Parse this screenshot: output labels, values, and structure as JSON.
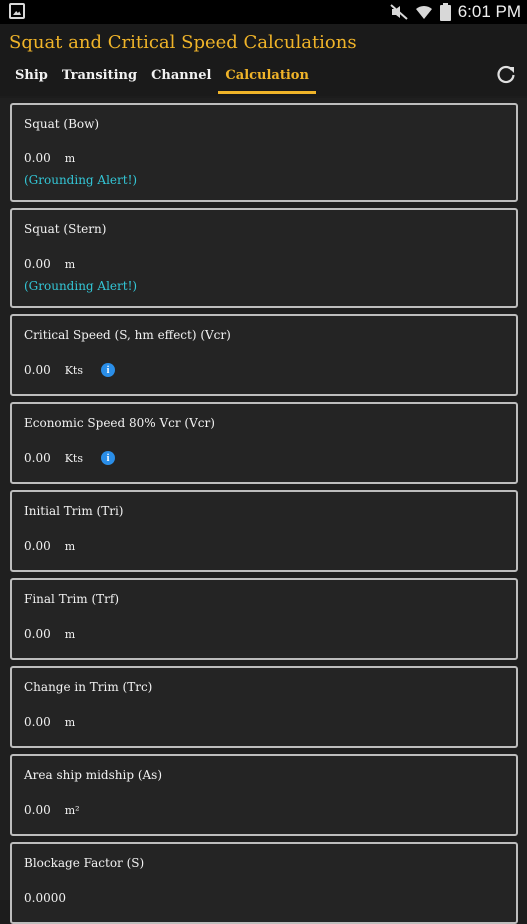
{
  "status_bar": {
    "time": "6:01 PM",
    "icons": [
      "image-icon",
      "mute-icon",
      "wifi-icon",
      "battery-icon"
    ]
  },
  "app": {
    "title": "Squat and Critical Speed Calculations",
    "accent_color": "#f0b429",
    "alert_color": "#33c6d6",
    "tabs": [
      {
        "label": "Ship",
        "active": false
      },
      {
        "label": "Transiting",
        "active": false
      },
      {
        "label": "Channel",
        "active": false
      },
      {
        "label": "Calculation",
        "active": true
      }
    ],
    "refresh_icon": "refresh-icon"
  },
  "results": [
    {
      "title": "Squat (Bow)",
      "value": "0.00",
      "unit": "m",
      "alert": "(Grounding Alert!)"
    },
    {
      "title": "Squat (Stern)",
      "value": "0.00",
      "unit": "m",
      "alert": "(Grounding Alert!)"
    },
    {
      "title": "Critical Speed (S, hm effect) (Vcr)",
      "value": "0.00",
      "unit": "Kts",
      "info": "i"
    },
    {
      "title": "Economic Speed 80% Vcr (Vcr)",
      "value": "0.00",
      "unit": "Kts",
      "info": "i"
    },
    {
      "title": "Initial Trim (Tri)",
      "value": "0.00",
      "unit": "m"
    },
    {
      "title": "Final Trim (Trf)",
      "value": "0.00",
      "unit": "m"
    },
    {
      "title": "Change in Trim (Trc)",
      "value": "0.00",
      "unit": "m"
    },
    {
      "title": "Area ship midship (As)",
      "value": "0.00",
      "unit": "m²"
    },
    {
      "title": "Blockage Factor (S)",
      "value": "0.0000",
      "unit": ""
    }
  ]
}
